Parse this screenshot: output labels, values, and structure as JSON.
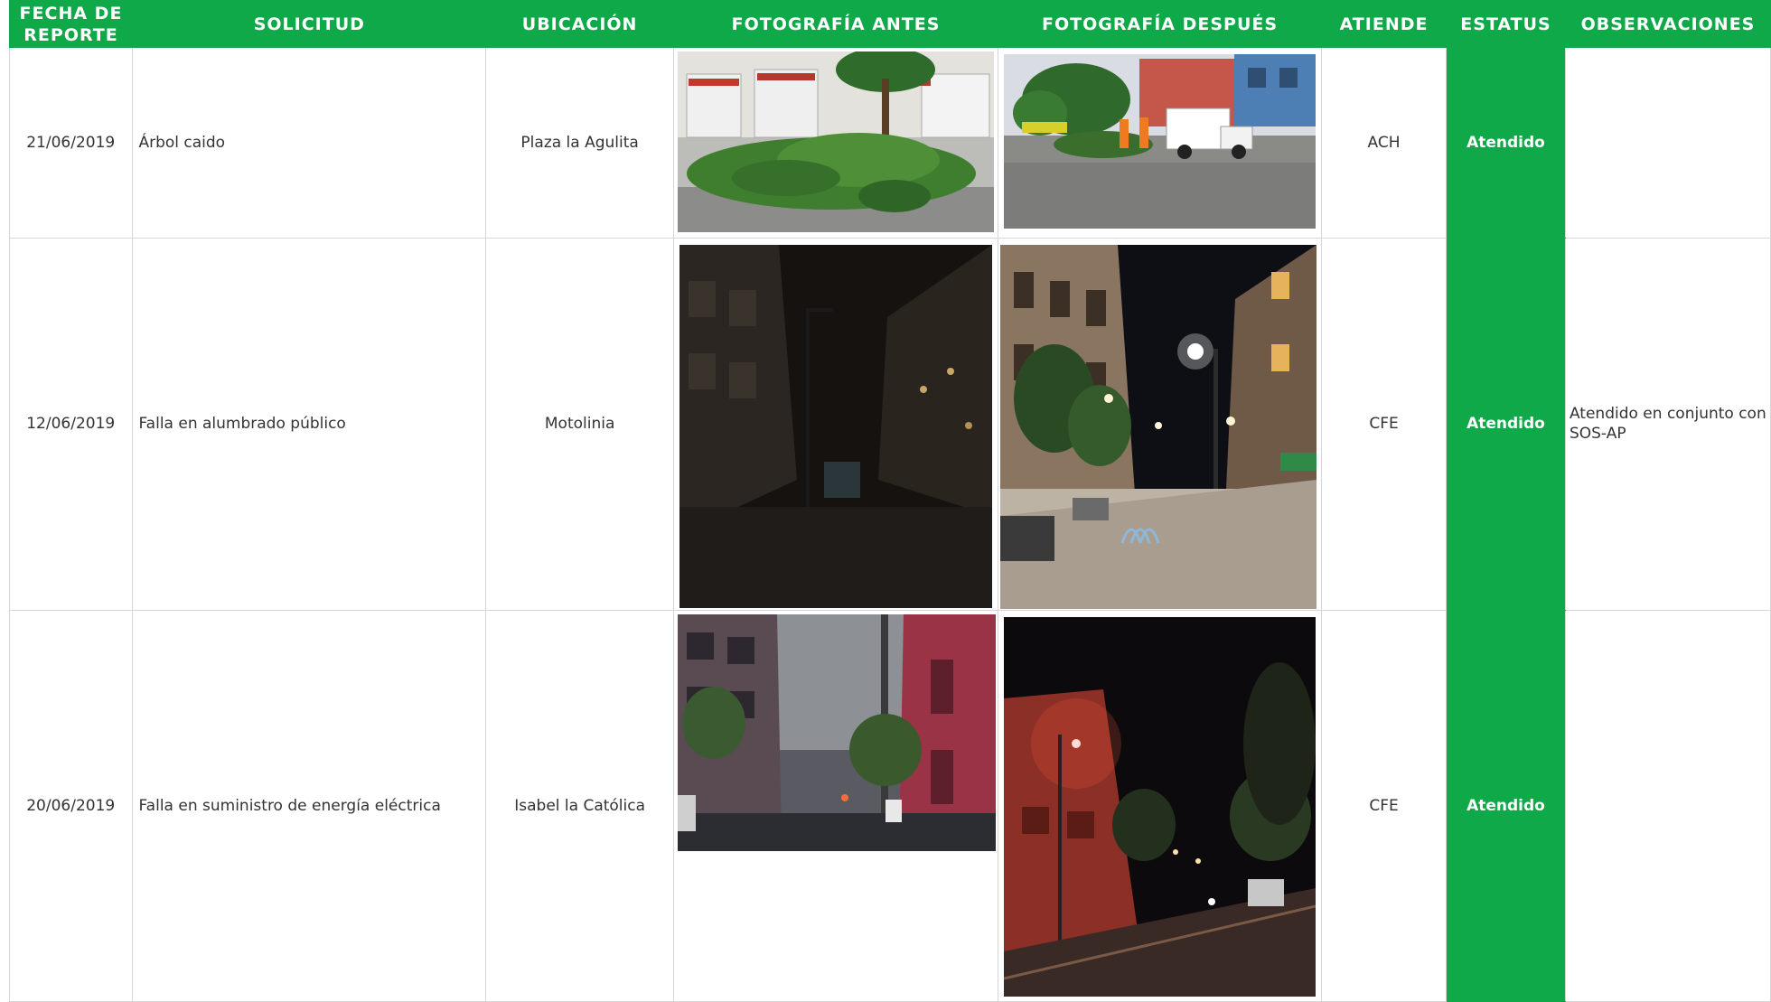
{
  "headers": {
    "date": "FECHA DE REPORTE",
    "request": "SOLICITUD",
    "location": "UBICACIÓN",
    "photo_before": "FOTOGRAFÍA ANTES",
    "photo_after": "FOTOGRAFÍA DESPUÉS",
    "attends": "ATIENDE",
    "status": "ESTATUS",
    "notes": "OBSERVACIONES"
  },
  "rows": [
    {
      "date": "21/06/2019",
      "request": "Árbol caido",
      "location": "Plaza la Agulita",
      "attends": "ACH",
      "status": "Atendido",
      "notes": ""
    },
    {
      "date": "12/06/2019",
      "request": "Falla en alumbrado público",
      "location": "Motolinia",
      "attends": "CFE",
      "status": "Atendido",
      "notes": "Atendido en conjunto con SOS-AP"
    },
    {
      "date": "20/06/2019",
      "request": "Falla en suministro de energía eléctrica",
      "location": "Isabel la Católica",
      "attends": "CFE",
      "status": "Atendido",
      "notes": ""
    }
  ],
  "colors": {
    "brand_green": "#10a94a",
    "border": "#d6d6d6"
  }
}
